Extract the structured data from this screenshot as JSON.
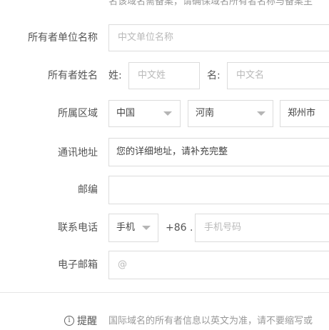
{
  "top_note": "名该域名需备案，请确保域名所有者名称与备案主",
  "form": {
    "org_name": {
      "label": "所有者单位名称",
      "placeholder": "中文单位名称"
    },
    "owner_name": {
      "label": "所有者姓名",
      "surname_label": "姓:",
      "surname_placeholder": "中文姓",
      "given_label": "名:",
      "given_placeholder": "中文名"
    },
    "region": {
      "label": "所属区域",
      "country": "中国",
      "province": "河南",
      "city": "郑州市"
    },
    "address": {
      "label": "通讯地址",
      "value": "您的详细地址，请补充完整"
    },
    "postcode": {
      "label": "邮编",
      "value": ""
    },
    "phone": {
      "label": "联系电话",
      "type": "手机",
      "prefix": "+86 .",
      "placeholder": "手机号码"
    },
    "email": {
      "label": "电子邮箱",
      "placeholder": "@"
    }
  },
  "tip": {
    "icon": "info-circle-icon",
    "label": "提醒",
    "text": "国际域名的所有者信息以英文为准，请不要缩写或"
  }
}
